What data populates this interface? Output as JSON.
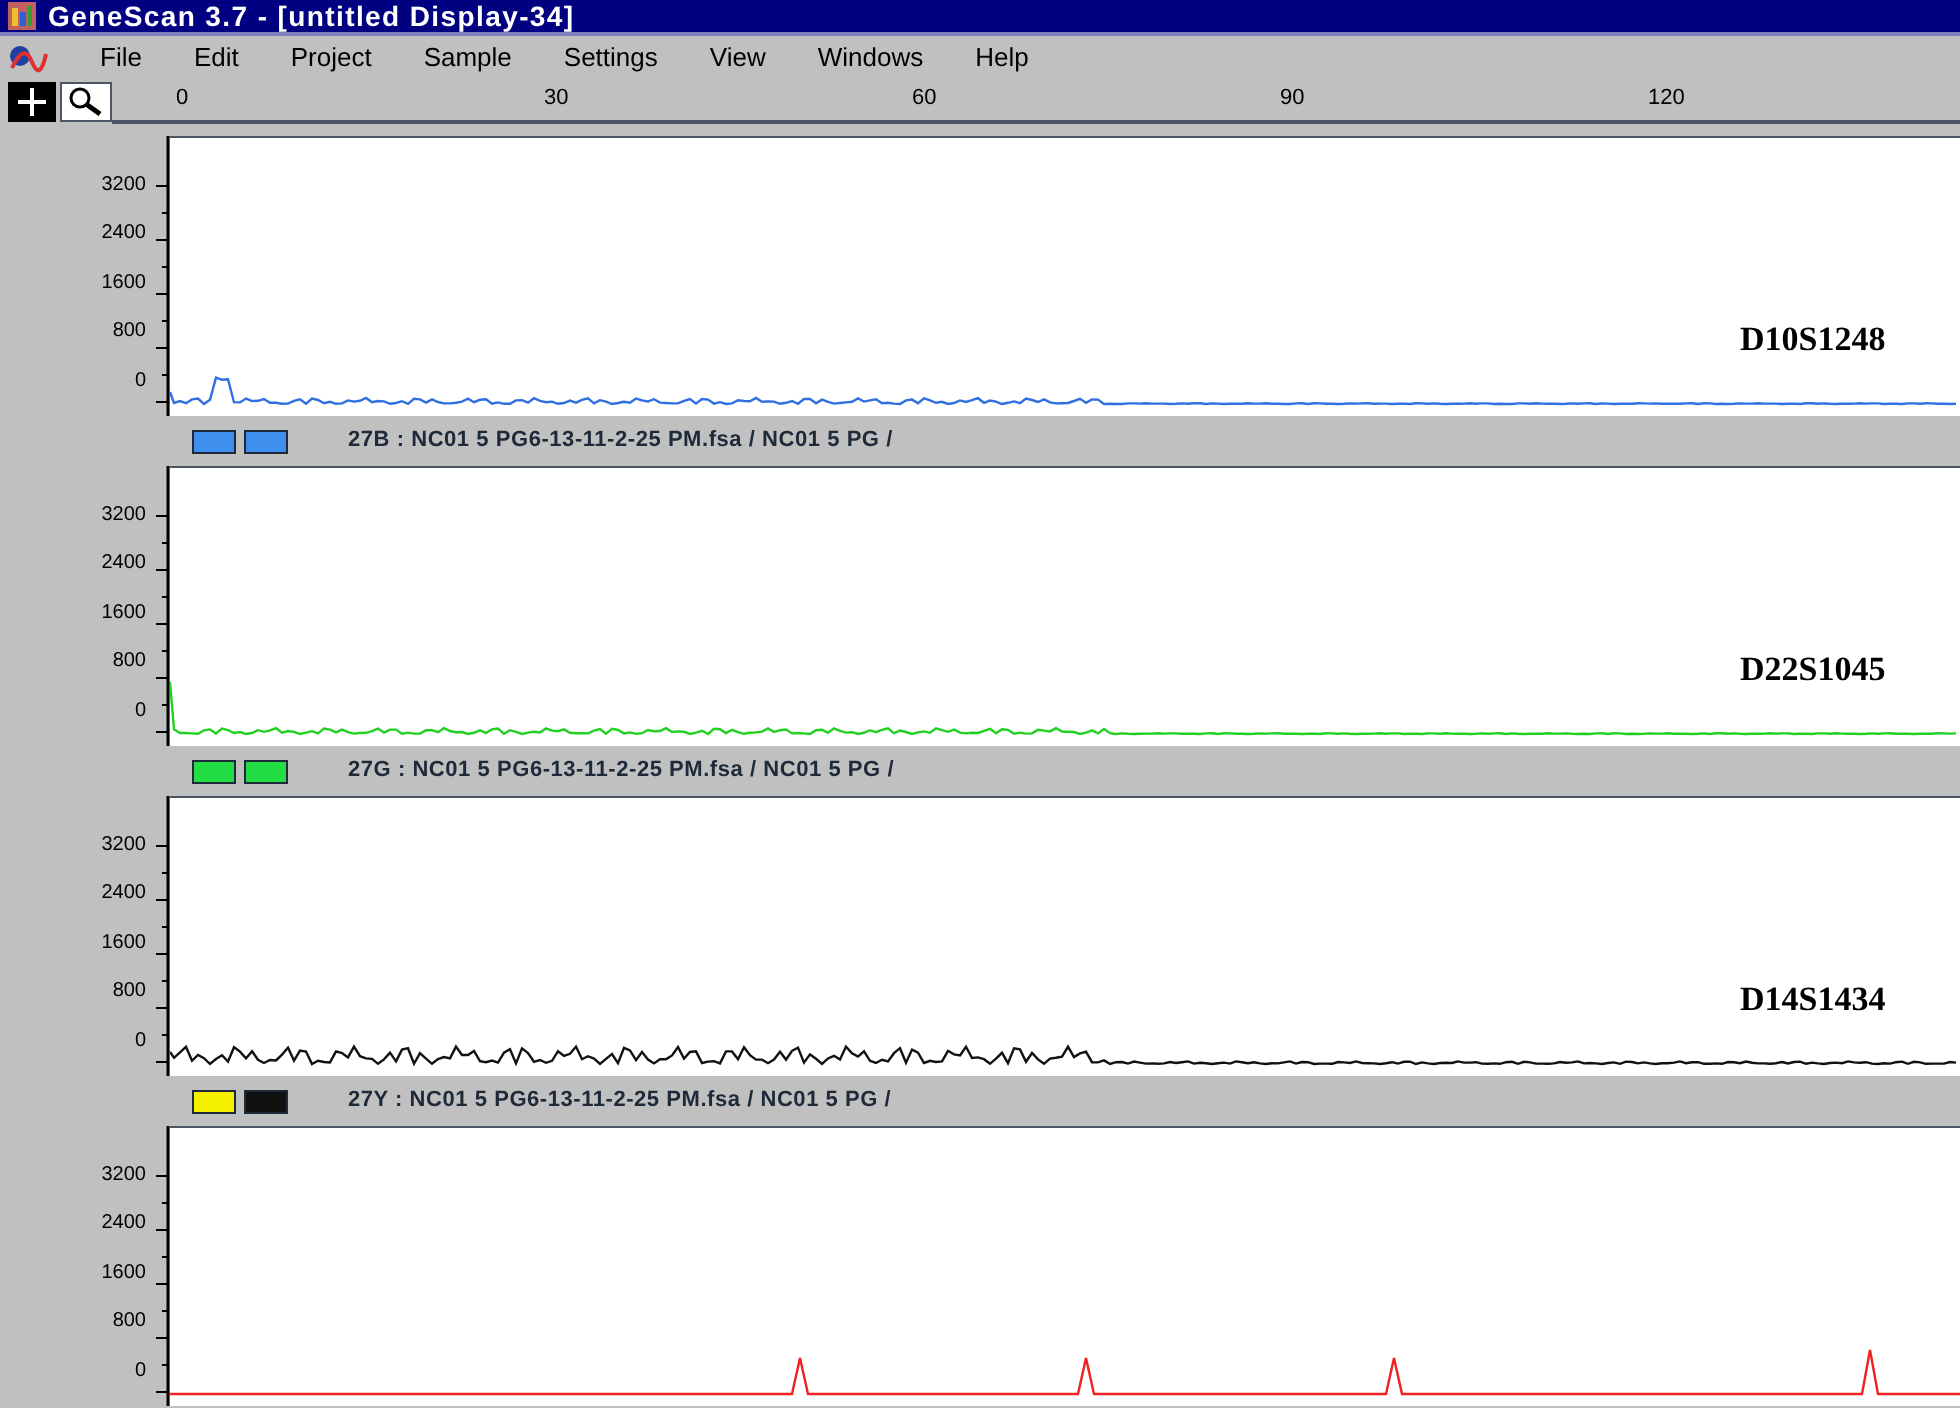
{
  "window": {
    "title": "GeneScan 3.7 - [untitled Display-34]"
  },
  "menu": [
    "File",
    "Edit",
    "Project",
    "Sample",
    "Settings",
    "View",
    "Windows",
    "Help"
  ],
  "ruler": {
    "ticks": [
      "0",
      "30",
      "60",
      "90",
      "120"
    ]
  },
  "panels": [
    {
      "y_ticks": [
        "3200",
        "2400",
        "1600",
        "800",
        "0"
      ],
      "marker": "D10S1248",
      "color": "#2f6fe0",
      "kind": "noise",
      "legend": {
        "swatches": [
          {
            "color": "#3f8fef"
          },
          {
            "color": "#3f8fef"
          }
        ],
        "text": "27B : NC01 5 PG6-13-11-2-25 PM.fsa / NC01 5 PG /"
      }
    },
    {
      "y_ticks": [
        "3200",
        "2400",
        "1600",
        "800",
        "0"
      ],
      "marker": "D22S1045",
      "color": "#22d022",
      "kind": "noise",
      "legend": {
        "swatches": [
          {
            "color": "#22dd44"
          },
          {
            "color": "#22dd44"
          }
        ],
        "text": "27G : NC01 5 PG6-13-11-2-25 PM.fsa / NC01 5 PG /"
      }
    },
    {
      "y_ticks": [
        "3200",
        "2400",
        "1600",
        "800",
        "0"
      ],
      "marker": "D14S1434",
      "color": "#111111",
      "kind": "noise",
      "legend": {
        "swatches": [
          {
            "color": "#f5f000"
          },
          {
            "color": "#111111"
          }
        ],
        "text": "27Y : NC01 5 PG6-13-11-2-25 PM.fsa / NC01 5 PG /"
      }
    },
    {
      "y_ticks": [
        "3200",
        "2400",
        "1600",
        "800",
        "0"
      ],
      "color": "#ee2222",
      "kind": "peaks"
    }
  ]
}
